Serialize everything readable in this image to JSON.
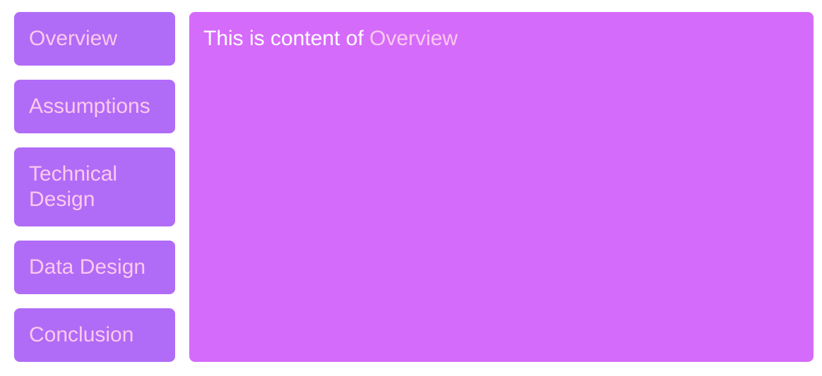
{
  "sidebar": {
    "items": [
      {
        "label": "Overview"
      },
      {
        "label": "Assumptions"
      },
      {
        "label": "Technical Design"
      },
      {
        "label": "Data Design"
      },
      {
        "label": "Conclusion"
      }
    ]
  },
  "content": {
    "prefix": "This is content of ",
    "active_tab": "Overview"
  },
  "colors": {
    "tab_background": "#b06cf7",
    "tab_text": "#fbc9ee",
    "content_background": "#d56bfb",
    "content_text": "#ffffff"
  }
}
